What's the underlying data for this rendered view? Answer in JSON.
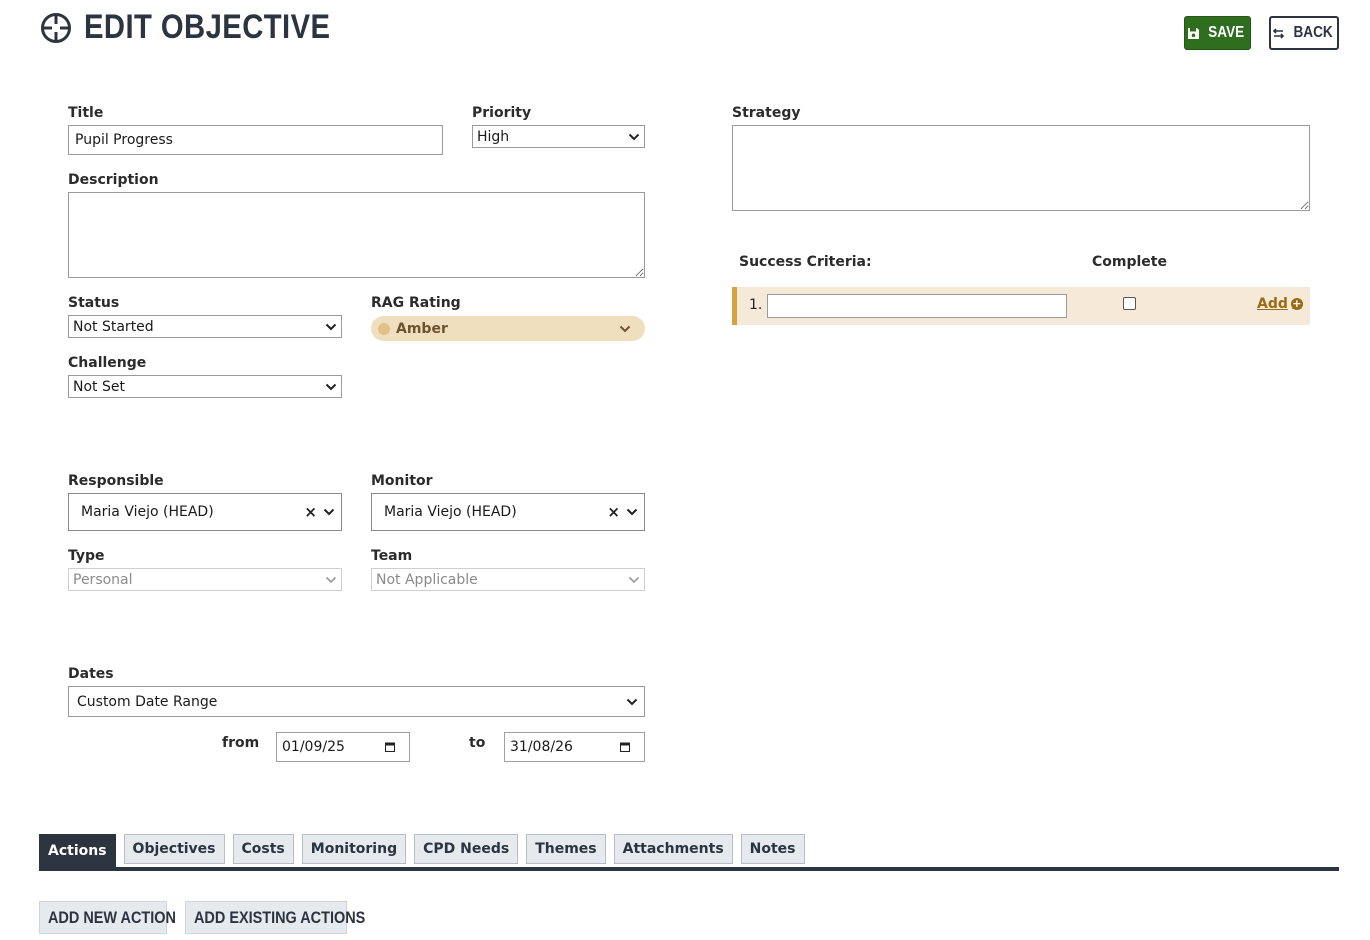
{
  "header": {
    "title": "EDIT OBJECTIVE",
    "icon": "crosshair-icon",
    "save_label": "SAVE",
    "back_label": "BACK"
  },
  "form": {
    "title": {
      "label": "Title",
      "value": "Pupil Progress"
    },
    "priority": {
      "label": "Priority",
      "value": "High"
    },
    "description": {
      "label": "Description",
      "value": ""
    },
    "status": {
      "label": "Status",
      "value": "Not Started"
    },
    "rag_rating": {
      "label": "RAG Rating",
      "value": "Amber",
      "color": "#e2c188"
    },
    "challenge": {
      "label": "Challenge",
      "value": "Not Set"
    },
    "responsible": {
      "label": "Responsible",
      "value": "Maria Viejo (HEAD)",
      "clear": "×"
    },
    "monitor": {
      "label": "Monitor",
      "value": "Maria Viejo (HEAD)",
      "clear": "×"
    },
    "type": {
      "label": "Type",
      "value": "Personal"
    },
    "team": {
      "label": "Team",
      "value": "Not Applicable"
    },
    "dates": {
      "label": "Dates",
      "value": "Custom Date Range",
      "from_label": "from",
      "from_value": "01/09/25",
      "to_label": "to",
      "to_value": "31/08/26"
    },
    "strategy": {
      "label": "Strategy",
      "value": ""
    }
  },
  "success_criteria": {
    "label": "Success Criteria:",
    "complete_label": "Complete",
    "rows": [
      {
        "number": "1.",
        "value": "",
        "complete": false
      }
    ],
    "add_label": "Add"
  },
  "tabs": [
    {
      "label": "Actions",
      "active": true
    },
    {
      "label": "Objectives",
      "active": false
    },
    {
      "label": "Costs",
      "active": false
    },
    {
      "label": "Monitoring",
      "active": false
    },
    {
      "label": "CPD Needs",
      "active": false
    },
    {
      "label": "Themes",
      "active": false
    },
    {
      "label": "Attachments",
      "active": false
    },
    {
      "label": "Notes",
      "active": false
    }
  ],
  "actions": {
    "add_new_label": "ADD NEW ACTION",
    "add_existing_label": "ADD EXISTING ACTIONS"
  },
  "colors": {
    "primary": "#2c3440",
    "save_green": "#2e6e1e",
    "amber": "#f0dfbf",
    "criteria_accent": "#d4a341",
    "link_gold": "#9a6b15"
  }
}
